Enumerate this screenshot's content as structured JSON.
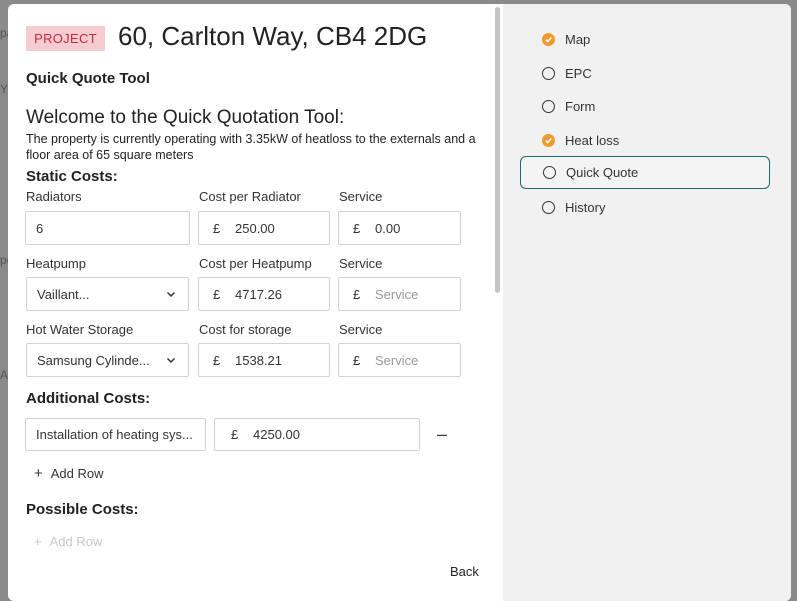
{
  "background": {
    "fragments": [
      "pa",
      "YE",
      "po",
      "Al"
    ]
  },
  "header": {
    "badge": "PROJECT",
    "title": "60, Carlton Way, CB4 2DG",
    "subtitle": "Quick Quote Tool"
  },
  "intro": {
    "heading": "Welcome to the Quick Quotation Tool:",
    "description": "The property is currently operating with 3.35kW of heatloss to the externals and a floor area of 65 square meters"
  },
  "static_costs": {
    "heading": "Static Costs:",
    "radiators": {
      "label": "Radiators",
      "value": "6",
      "cost_label": "Cost per Radiator",
      "cost_currency": "£",
      "cost_value": "250.00",
      "service_label": "Service",
      "service_currency": "£",
      "service_value": "0.00"
    },
    "heatpump": {
      "label": "Heatpump",
      "value": "Vaillant...",
      "cost_label": "Cost per Heatpump",
      "cost_currency": "£",
      "cost_value": "4717.26",
      "service_label": "Service",
      "service_currency": "£",
      "service_placeholder": "Service"
    },
    "storage": {
      "label": "Hot Water Storage",
      "value": "Samsung Cylinde...",
      "cost_label": "Cost for storage",
      "cost_currency": "£",
      "cost_value": "1538.21",
      "service_label": "Service",
      "service_currency": "£",
      "service_placeholder": "Service"
    }
  },
  "additional_costs": {
    "heading": "Additional Costs:",
    "rows": [
      {
        "description": "Installation of heating sys...",
        "currency": "£",
        "amount": "4250.00",
        "remove": "–"
      }
    ],
    "add_row": "Add Row",
    "add_icon": "+"
  },
  "possible_costs": {
    "heading": "Possible Costs:",
    "add_row": "Add Row",
    "add_icon": "+"
  },
  "footer": {
    "back": "Back"
  },
  "steps": [
    {
      "label": "Map",
      "state": "done"
    },
    {
      "label": "EPC",
      "state": "todo"
    },
    {
      "label": "Form",
      "state": "todo"
    },
    {
      "label": "Heat loss",
      "state": "done"
    },
    {
      "label": "Quick Quote",
      "state": "active"
    },
    {
      "label": "History",
      "state": "todo"
    }
  ],
  "colors": {
    "accent_done": "#f29a2e",
    "active_border": "#1d6b6a",
    "badge_bg": "#f7ccd1",
    "badge_text": "#c22a3d"
  }
}
